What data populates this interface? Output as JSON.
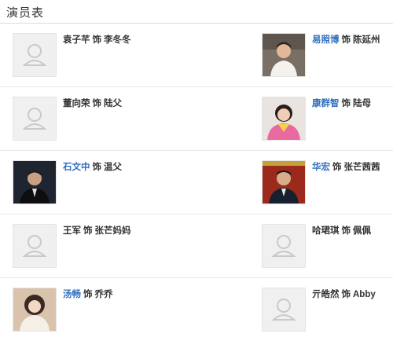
{
  "section": {
    "title": "演员表"
  },
  "cast": [
    {
      "actor": "袁子芊",
      "linked": false,
      "role_word": "饰",
      "role": "李冬冬",
      "photo": "placeholder"
    },
    {
      "actor": "易照博",
      "linked": true,
      "role_word": "饰",
      "role": "陈延州",
      "photo": "man-white-shirt"
    },
    {
      "actor": "董向荣",
      "linked": false,
      "role_word": "饰",
      "role": "陆父",
      "photo": "placeholder"
    },
    {
      "actor": "康群智",
      "linked": true,
      "role_word": "饰",
      "role": "陆母",
      "photo": "woman-pink"
    },
    {
      "actor": "石文中",
      "linked": true,
      "role_word": "饰",
      "role": "温父",
      "photo": "man-dark-suit"
    },
    {
      "actor": "华宏",
      "linked": true,
      "role_word": "饰",
      "role": "张芒茜茜",
      "photo": "man-red-background"
    },
    {
      "actor": "王军",
      "linked": false,
      "role_word": "饰",
      "role": "张芒妈妈",
      "photo": "placeholder"
    },
    {
      "actor": "哈珺琪",
      "linked": false,
      "role_word": "饰",
      "role": "佩佩",
      "photo": "placeholder"
    },
    {
      "actor": "汤畅",
      "linked": true,
      "role_word": "饰",
      "role": "乔乔",
      "photo": "woman-light"
    },
    {
      "actor": "亓皓然",
      "linked": false,
      "role_word": "饰",
      "role": "Abby",
      "photo": "placeholder"
    }
  ]
}
